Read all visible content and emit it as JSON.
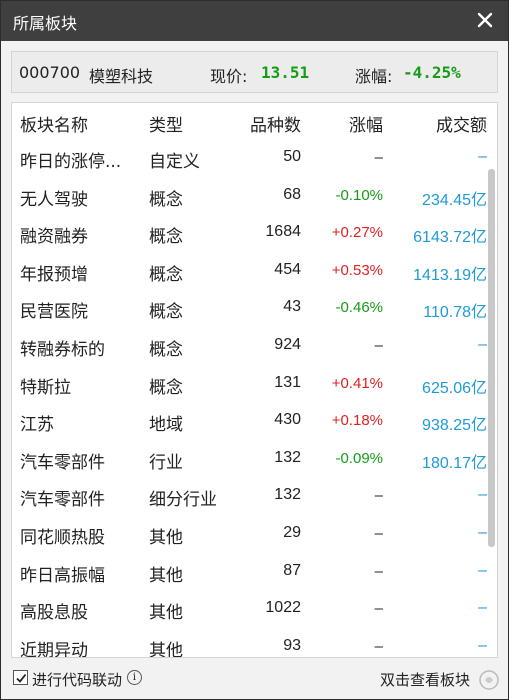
{
  "window": {
    "title": "所属板块"
  },
  "stock": {
    "code": "000700",
    "name": "模塑科技",
    "price_label": "现价:",
    "price": "13.51",
    "change_label": "涨幅:",
    "change": "-4.25%"
  },
  "table": {
    "headers": {
      "name": "板块名称",
      "type": "类型",
      "count": "品种数",
      "change": "涨幅",
      "amount": "成交额"
    },
    "rows": [
      {
        "name": "昨日的涨停...",
        "type": "自定义",
        "count": "50",
        "change": "–",
        "change_dir": "none",
        "amount": "–"
      },
      {
        "name": "无人驾驶",
        "type": "概念",
        "count": "68",
        "change": "-0.10%",
        "change_dir": "down",
        "amount": "234.45亿"
      },
      {
        "name": "融资融券",
        "type": "概念",
        "count": "1684",
        "change": "+0.27%",
        "change_dir": "up",
        "amount": "6143.72亿"
      },
      {
        "name": "年报预增",
        "type": "概念",
        "count": "454",
        "change": "+0.53%",
        "change_dir": "up",
        "amount": "1413.19亿"
      },
      {
        "name": "民营医院",
        "type": "概念",
        "count": "43",
        "change": "-0.46%",
        "change_dir": "down",
        "amount": "110.78亿"
      },
      {
        "name": "转融券标的",
        "type": "概念",
        "count": "924",
        "change": "–",
        "change_dir": "none",
        "amount": "–"
      },
      {
        "name": "特斯拉",
        "type": "概念",
        "count": "131",
        "change": "+0.41%",
        "change_dir": "up",
        "amount": "625.06亿"
      },
      {
        "name": "江苏",
        "type": "地域",
        "count": "430",
        "change": "+0.18%",
        "change_dir": "up",
        "amount": "938.25亿"
      },
      {
        "name": "汽车零部件",
        "type": "行业",
        "count": "132",
        "change": "-0.09%",
        "change_dir": "down",
        "amount": "180.17亿"
      },
      {
        "name": "汽车零部件",
        "type": "细分行业",
        "count": "132",
        "change": "–",
        "change_dir": "none",
        "amount": "–"
      },
      {
        "name": "同花顺热股",
        "type": "其他",
        "count": "29",
        "change": "–",
        "change_dir": "none",
        "amount": "–"
      },
      {
        "name": "昨日高振幅",
        "type": "其他",
        "count": "87",
        "change": "–",
        "change_dir": "none",
        "amount": "–"
      },
      {
        "name": "高股息股",
        "type": "其他",
        "count": "1022",
        "change": "–",
        "change_dir": "none",
        "amount": "–"
      },
      {
        "name": "近期异动",
        "type": "其他",
        "count": "93",
        "change": "–",
        "change_dir": "none",
        "amount": "–"
      }
    ]
  },
  "footer": {
    "checkbox_label": "进行代码联动",
    "checkbox_checked": true,
    "hint": "双击查看板块"
  },
  "colors": {
    "up": "#e01f1f",
    "down": "#169c16",
    "amount": "#1e9ad6",
    "titlebar": "#3f3f3f"
  }
}
